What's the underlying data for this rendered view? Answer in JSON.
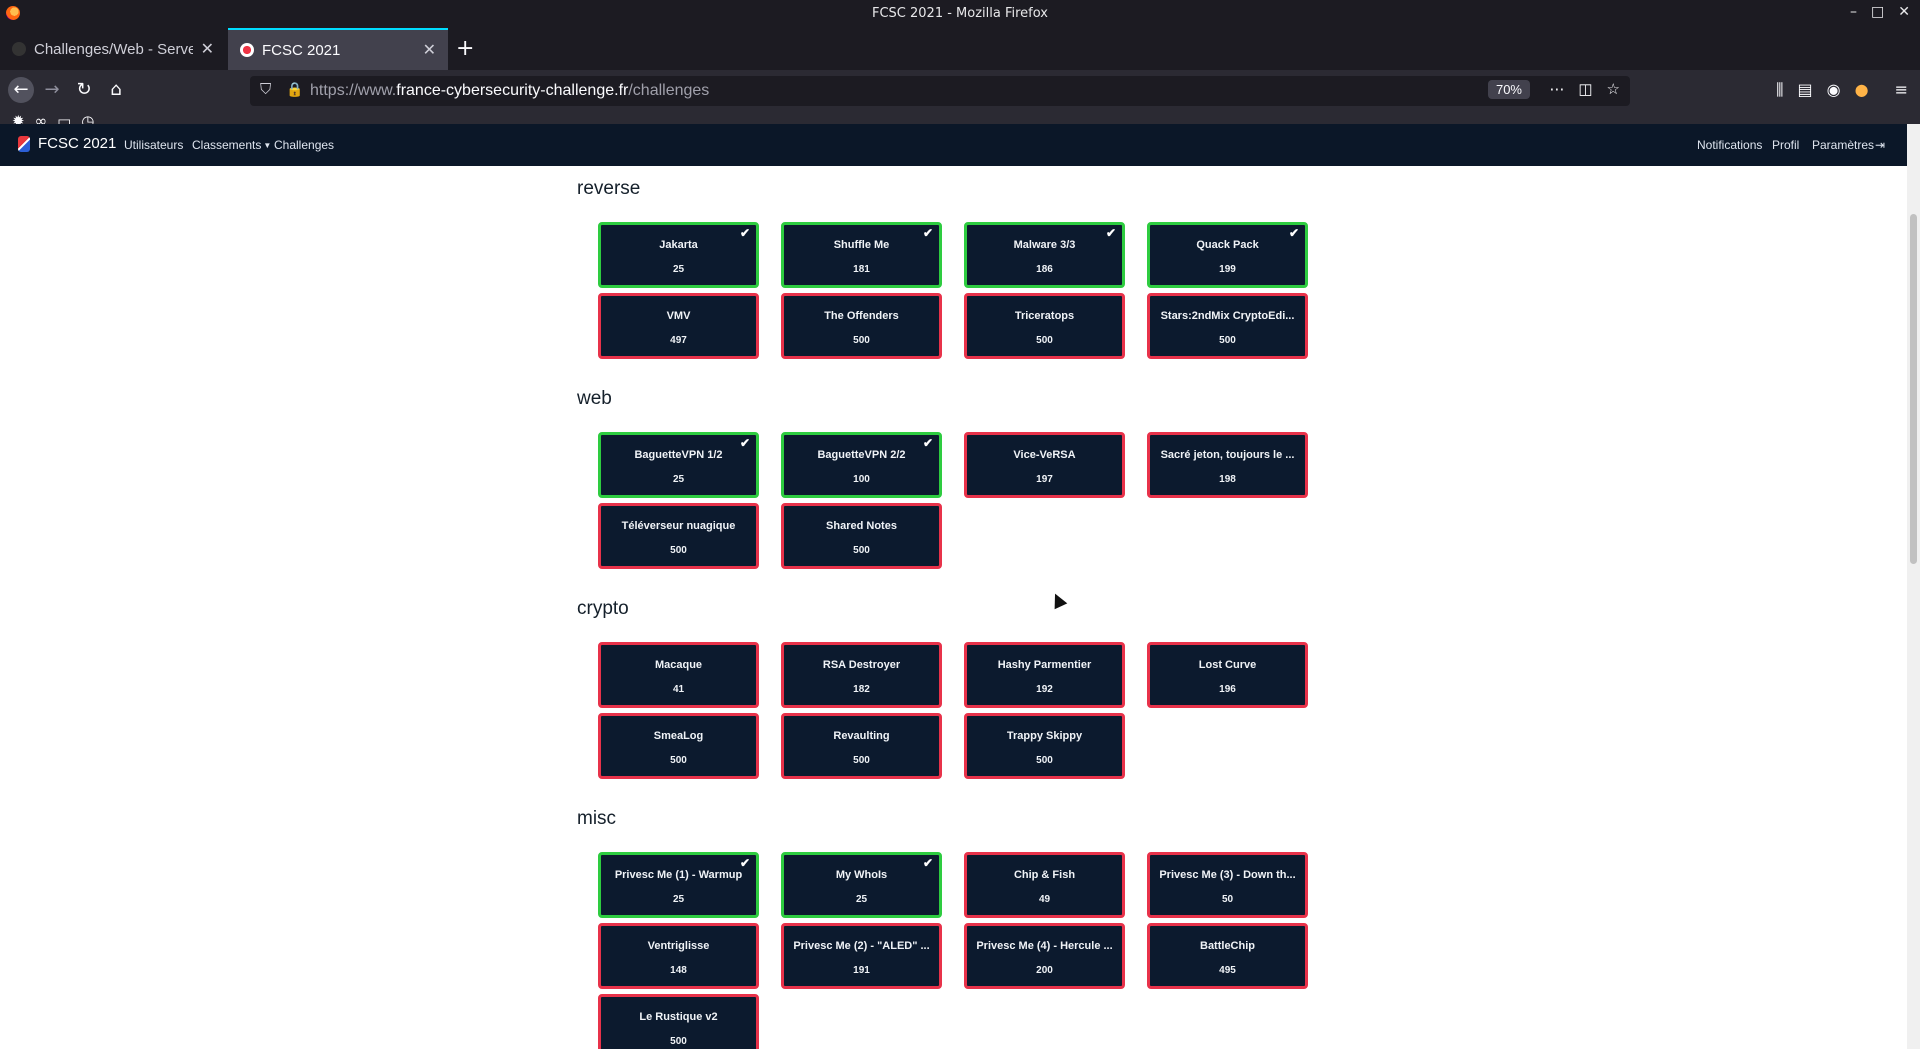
{
  "window": {
    "title": "FCSC 2021 - Mozilla Firefox"
  },
  "tabs": [
    {
      "label": "Challenges/Web - Server",
      "active": false
    },
    {
      "label": "FCSC 2021",
      "active": true
    }
  ],
  "urlbar": {
    "url_prefix": "https://www.",
    "url_host": "france-cybersecurity-challenge.fr",
    "url_path": "/challenges",
    "zoom": "70%"
  },
  "site_nav": {
    "brand": "FCSC 2021",
    "links": {
      "users": "Utilisateurs",
      "rankings": "Classements",
      "challenges": "Challenges"
    },
    "right_links": {
      "notifications": "Notifications",
      "profile": "Profil",
      "settings": "Paramètres"
    }
  },
  "colors": {
    "solved": "#2ecc40",
    "unsolved": "#e8324a",
    "card_bg": "#0c1a2e",
    "navbar": "#0b1728"
  },
  "sections": [
    {
      "title": "reverse",
      "challenges": [
        {
          "name": "Jakarta",
          "points": "25",
          "solved": true
        },
        {
          "name": "Shuffle Me",
          "points": "181",
          "solved": true
        },
        {
          "name": "Malware 3/3",
          "points": "186",
          "solved": true
        },
        {
          "name": "Quack Pack",
          "points": "199",
          "solved": true
        },
        {
          "name": "VMV",
          "points": "497",
          "solved": false
        },
        {
          "name": "The Offenders",
          "points": "500",
          "solved": false
        },
        {
          "name": "Triceratops",
          "points": "500",
          "solved": false
        },
        {
          "name": "Stars:2ndMix CryptoEdi...",
          "points": "500",
          "solved": false
        }
      ]
    },
    {
      "title": "web",
      "challenges": [
        {
          "name": "BaguetteVPN 1/2",
          "points": "25",
          "solved": true
        },
        {
          "name": "BaguetteVPN 2/2",
          "points": "100",
          "solved": true
        },
        {
          "name": "Vice-VeRSA",
          "points": "197",
          "solved": false
        },
        {
          "name": "Sacré jeton, toujours le ...",
          "points": "198",
          "solved": false
        },
        {
          "name": "Téléverseur nuagique",
          "points": "500",
          "solved": false
        },
        {
          "name": "Shared Notes",
          "points": "500",
          "solved": false
        }
      ]
    },
    {
      "title": "crypto",
      "challenges": [
        {
          "name": "Macaque",
          "points": "41",
          "solved": false
        },
        {
          "name": "RSA Destroyer",
          "points": "182",
          "solved": false
        },
        {
          "name": "Hashy Parmentier",
          "points": "192",
          "solved": false
        },
        {
          "name": "Lost Curve",
          "points": "196",
          "solved": false
        },
        {
          "name": "SmeaLog",
          "points": "500",
          "solved": false
        },
        {
          "name": "Revaulting",
          "points": "500",
          "solved": false
        },
        {
          "name": "Trappy Skippy",
          "points": "500",
          "solved": false
        }
      ]
    },
    {
      "title": "misc",
      "challenges": [
        {
          "name": "Privesc Me (1) - Warmup",
          "points": "25",
          "solved": true
        },
        {
          "name": "My WhoIs",
          "points": "25",
          "solved": true
        },
        {
          "name": "Chip & Fish",
          "points": "49",
          "solved": false
        },
        {
          "name": "Privesc Me (3) - Down th...",
          "points": "50",
          "solved": false
        },
        {
          "name": "Ventriglisse",
          "points": "148",
          "solved": false
        },
        {
          "name": "Privesc Me (2) - \"ALED\" ...",
          "points": "191",
          "solved": false
        },
        {
          "name": "Privesc Me (4) - Hercule ...",
          "points": "200",
          "solved": false
        },
        {
          "name": "BattleChip",
          "points": "495",
          "solved": false
        },
        {
          "name": "Le Rustique v2",
          "points": "500",
          "solved": false
        }
      ]
    }
  ]
}
